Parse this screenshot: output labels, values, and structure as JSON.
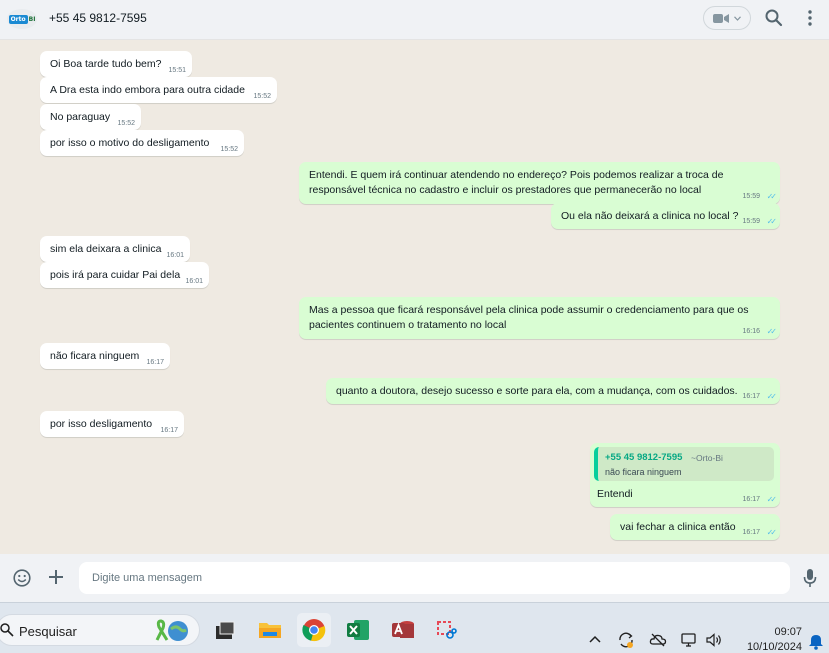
{
  "header": {
    "avatar_logo_left": "Orto",
    "avatar_logo_right": "BI",
    "contact_name": "+55 45 9812-7595",
    "icons": [
      "video-camera-icon",
      "chevron-down-icon",
      "search-icon",
      "kebab-menu-icon"
    ]
  },
  "messages": [
    {
      "dir": "in",
      "text": "Oi Boa tarde tudo bem?",
      "time": "15:51"
    },
    {
      "dir": "in",
      "text": "A Dra esta indo embora para outra cidade",
      "time": "15:52"
    },
    {
      "dir": "in",
      "text": "No paraguay",
      "time": "15:52"
    },
    {
      "dir": "in",
      "text": "por isso o motivo do desligamento",
      "time": "15:52"
    },
    {
      "dir": "out",
      "lines": [
        "Entendi. E quem irá continuar atendendo no endereço? Pois podemos realizar a troca de",
        "responsável técnica no cadastro e incluir os prestadores que permanecerão no local"
      ],
      "time": "15:59"
    },
    {
      "dir": "out",
      "text": "Ou ela não deixará a clinica no local ?",
      "time": "15:59"
    },
    {
      "dir": "in",
      "text": "sim ela deixara a clinica",
      "time": "16:01"
    },
    {
      "dir": "in",
      "text": "pois irá para cuidar Pai dela",
      "time": "16:01"
    },
    {
      "dir": "out",
      "lines": [
        "Mas a pessoa que ficará responsável pela clinica pode assumir o credenciamento para que os",
        "pacientes continuem o tratamento no local"
      ],
      "time": "16:16"
    },
    {
      "dir": "in",
      "text": "não ficara ninguem",
      "time": "16:17"
    },
    {
      "dir": "out",
      "text": "quanto a doutora, desejo sucesso e sorte para ela, com a mudança, com os cuidados.",
      "time": "16:17"
    },
    {
      "dir": "in",
      "text": "por isso desligamento",
      "time": "16:17"
    },
    {
      "dir": "out",
      "quote": {
        "name": "+55 45 9812-7595",
        "tag": "~Orto-Bi",
        "text": "não ficara ninguem"
      },
      "text": "Entendi",
      "time": "16:17"
    },
    {
      "dir": "out",
      "text": "vai fechar a clinica então",
      "time": "16:17"
    }
  ],
  "composer": {
    "placeholder": "Digite uma mensagem",
    "icons": [
      "emoji-icon",
      "plus-icon",
      "microphone-icon"
    ]
  },
  "taskbar": {
    "search_label": "Pesquisar",
    "apps": [
      "file-explorer-dark-icon",
      "folder-icon",
      "chrome-icon",
      "excel-icon",
      "access-icon",
      "snipping-tool-icon"
    ],
    "tray": [
      "chevron-up-icon",
      "sync-icon",
      "cloud-off-icon",
      "display-icon",
      "volume-icon"
    ],
    "time": "09:07",
    "date": "10/10/2024"
  },
  "colors": {
    "chat_bg": "#efeae2",
    "incoming": "#ffffff",
    "outgoing": "#d9fdd3",
    "read_ticks": "#53bdeb",
    "quote_accent": "#06cf9c"
  }
}
